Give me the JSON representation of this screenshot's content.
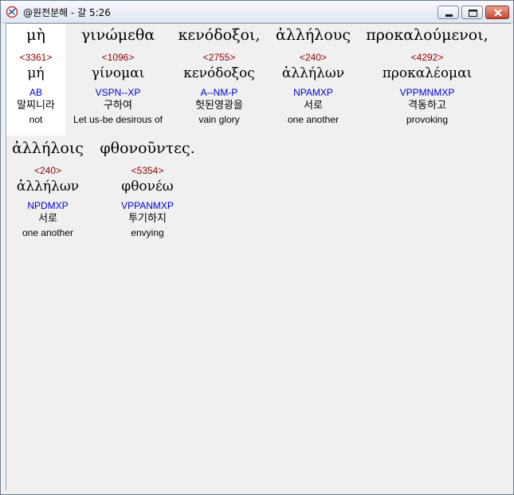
{
  "window": {
    "title": "@원전분해 - 갈 5:26",
    "icon": "app-logo-icon",
    "controls": [
      "minimize-icon",
      "maximize-icon",
      "close-icon"
    ]
  },
  "words": [
    {
      "greek": "μὴ",
      "strong": "<3361>",
      "lemma": "μή",
      "parse": "AB",
      "korean": "말찌니라",
      "english": "not"
    },
    {
      "greek": "γινώμεθα",
      "strong": "<1096>",
      "lemma": "γίνομαι",
      "parse": "VSPN--XP",
      "korean": "구하여",
      "english": "Let us-be desirous of"
    },
    {
      "greek": "κενόδοξοι,",
      "strong": "<2755>",
      "lemma": "κενόδοξος",
      "parse": "A--NM-P",
      "korean": "헛된영광을",
      "english": "vain glory"
    },
    {
      "greek": "ἀλλήλους",
      "strong": "<240>",
      "lemma": "ἀλλήλων",
      "parse": "NPAMXP",
      "korean": "서로",
      "english": "one another"
    },
    {
      "greek": "προκαλούμενοι,",
      "strong": "<4292>",
      "lemma": "προκαλέομαι",
      "parse": "VPPMNMXP",
      "korean": "격동하고",
      "english": "provoking"
    },
    {
      "greek": "ἀλλήλοις",
      "strong": "<240>",
      "lemma": "ἀλλήλων",
      "parse": "NPDMXP",
      "korean": "서로",
      "english": "one another"
    },
    {
      "greek": "φθονοῦντες.",
      "strong": "<5354>",
      "lemma": "φθονέω",
      "parse": "VPPANMXP",
      "korean": "투기하지",
      "english": "envying"
    }
  ],
  "colors": {
    "strong": "#8b0000",
    "parse": "#0000c8",
    "selected_background": "#ffffff",
    "client_background": "#f0f0f0"
  }
}
